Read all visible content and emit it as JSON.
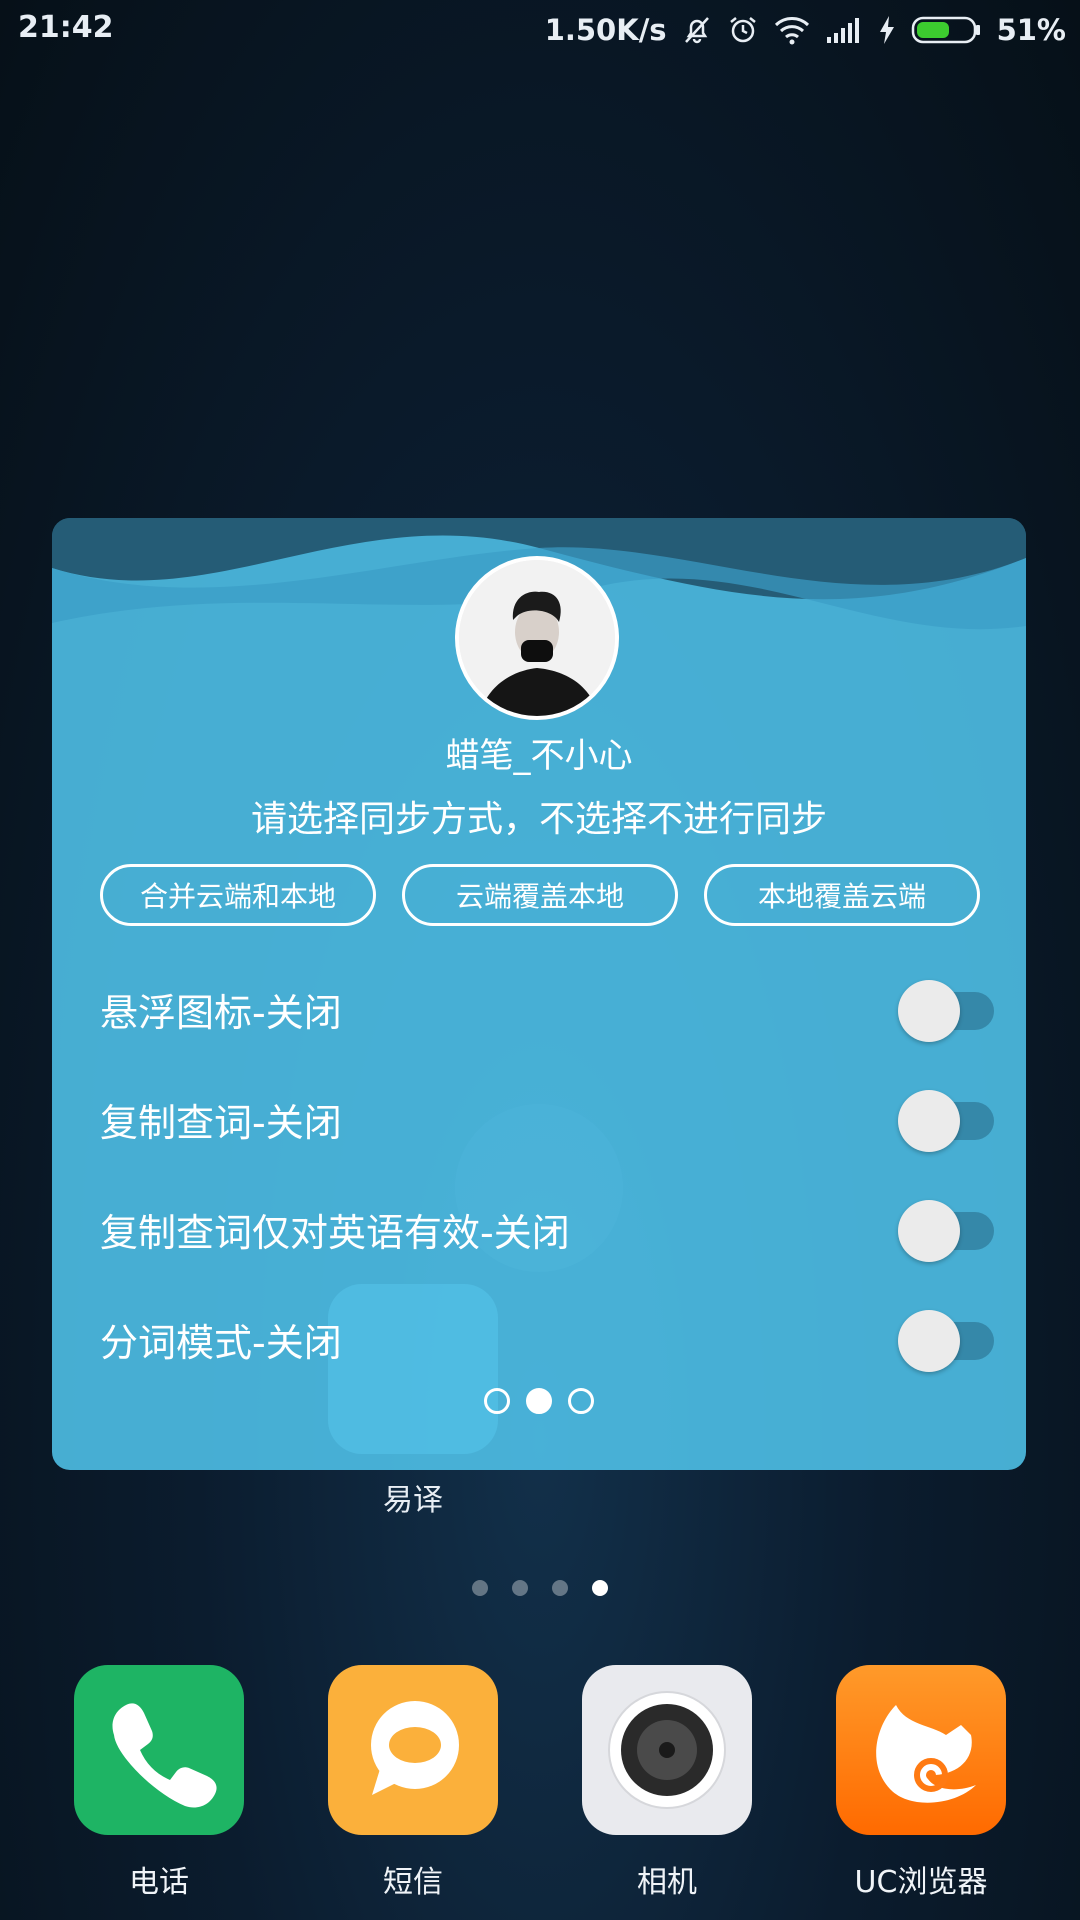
{
  "status_bar": {
    "time": "21:42",
    "net_speed": "1.50K/s",
    "battery_percent": "51%",
    "icons": [
      "mute-bell-icon",
      "alarm-icon",
      "wifi-icon",
      "signal-icon",
      "charging-icon",
      "battery-icon"
    ]
  },
  "background": {
    "app_label": "易译"
  },
  "widget": {
    "username": "蜡笔_不小心",
    "sync_prompt": "请选择同步方式，不选择不进行同步",
    "sync_options": [
      "合并云端和本地",
      "云端覆盖本地",
      "本地覆盖云端"
    ],
    "settings": [
      {
        "label": "悬浮图标-关闭",
        "on": false
      },
      {
        "label": "复制查词-关闭",
        "on": false
      },
      {
        "label": "复制查词仅对英语有效-关闭",
        "on": false
      },
      {
        "label": "分词模式-关闭",
        "on": false
      }
    ],
    "page_count": 3,
    "active_page": 1
  },
  "home_pages": {
    "count": 4,
    "active": 3
  },
  "dock": [
    {
      "label": "电话",
      "icon": "phone-icon",
      "color": "#1eb464"
    },
    {
      "label": "短信",
      "icon": "message-icon",
      "color": "#fbb03b"
    },
    {
      "label": "相机",
      "icon": "camera-icon",
      "color": "#e9eaee"
    },
    {
      "label": "UC浏览器",
      "icon": "uc-browser-icon",
      "color": "#ff7a12"
    }
  ]
}
